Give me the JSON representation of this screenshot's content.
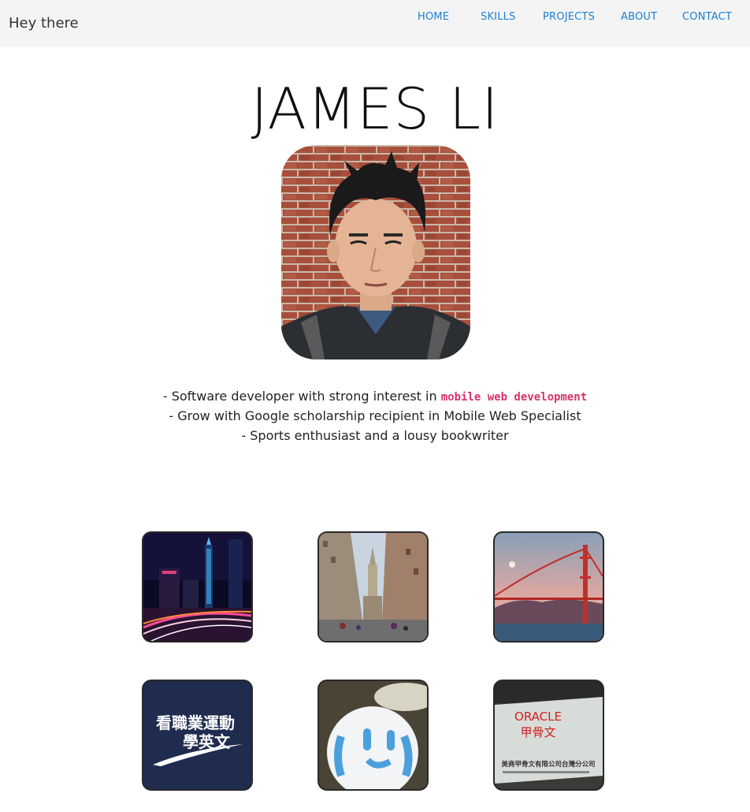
{
  "header": {
    "brand": "Hey there",
    "nav": [
      "HOME",
      "SKILLS",
      "PROJECTS",
      "ABOUT",
      "CONTACT"
    ]
  },
  "hero": {
    "name": "JAMES LI",
    "photo_icon": "portrait-photo"
  },
  "bio": {
    "line1_prefix": "- Software developer with strong interest in ",
    "line1_highlight": "mobile web development",
    "line2": "- Grow with Google scholarship recipient in Mobile Web Specialist",
    "line3": "- Sports enthusiast and a lousy bookwriter"
  },
  "gallery": {
    "tiles": [
      {
        "name": "taipei-night-tile"
      },
      {
        "name": "philadelphia-street-tile"
      },
      {
        "name": "golden-gate-bridge-tile"
      },
      {
        "name": "sports-english-logo-tile",
        "text_line1": "看職業運動",
        "text_line2": "學英文"
      },
      {
        "name": "smiley-pillow-tile"
      },
      {
        "name": "oracle-office-tile",
        "brand": "ORACLE",
        "brand_zh": "甲骨文",
        "sign_text": "美商甲骨文有限公司台灣分公司"
      }
    ]
  },
  "colors": {
    "nav_link": "#1a7fd4",
    "highlight": "#d6336c",
    "topbar_bg": "#f4f4f4"
  }
}
